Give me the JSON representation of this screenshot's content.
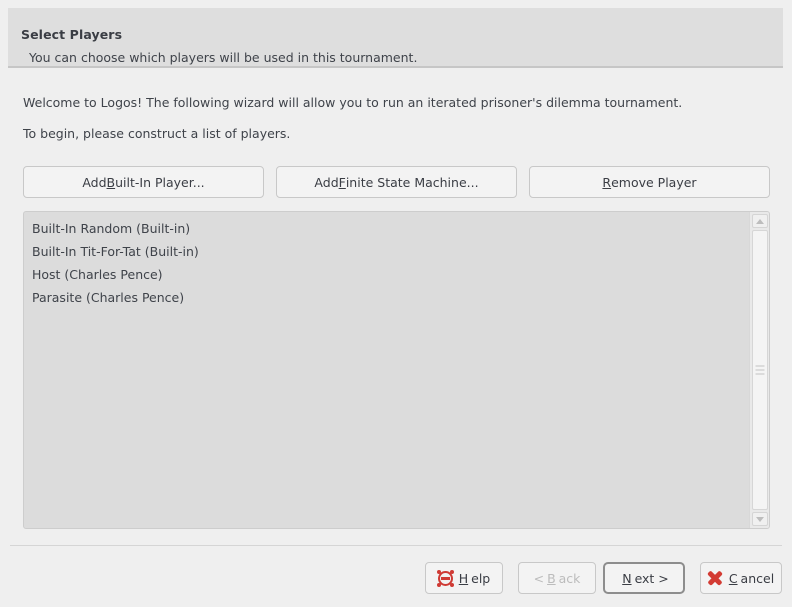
{
  "banner": {
    "title": "Select Players",
    "subtitle": "You can choose which players will be used in this tournament."
  },
  "body": {
    "paragraph_1": "Welcome to Logos!  The following wizard will allow you to run an iterated prisoner's dilemma tournament.",
    "paragraph_2": "To begin, please construct a list of players."
  },
  "actions": {
    "add_builtin": {
      "pre": "Add ",
      "mnemonic": "B",
      "post": "uilt-In Player..."
    },
    "add_fsm": {
      "pre": "Add ",
      "mnemonic": "F",
      "post": "inite State Machine..."
    },
    "remove_player": {
      "pre": "",
      "mnemonic": "R",
      "post": "emove Player"
    }
  },
  "player_list": {
    "items": [
      "Built-In Random (Built-in)",
      "Built-In Tit-For-Tat (Built-in)",
      "Host (Charles Pence)",
      "Parasite (Charles Pence)"
    ]
  },
  "scrollbar": {
    "up_arrow": "scroll-up",
    "down_arrow": "scroll-down"
  },
  "footer": {
    "help": {
      "pre": "",
      "mnemonic": "H",
      "post": "elp",
      "icon": "help-buoy-icon"
    },
    "back": {
      "pre": "< ",
      "mnemonic": "B",
      "post": "ack",
      "disabled": true
    },
    "next": {
      "pre": "",
      "mnemonic": "N",
      "post": "ext >",
      "default": true
    },
    "cancel": {
      "pre": "",
      "mnemonic": "C",
      "post": "ancel",
      "icon": "red-x-icon"
    }
  },
  "colors": {
    "window_background": "#efefef",
    "banner_background": "#dedede",
    "list_background": "#dcdcdc",
    "button_background": "#f3f3f3",
    "text": "#3f434a",
    "accent_red": "#cf3a34",
    "disabled_text": "#bcbcbc"
  }
}
